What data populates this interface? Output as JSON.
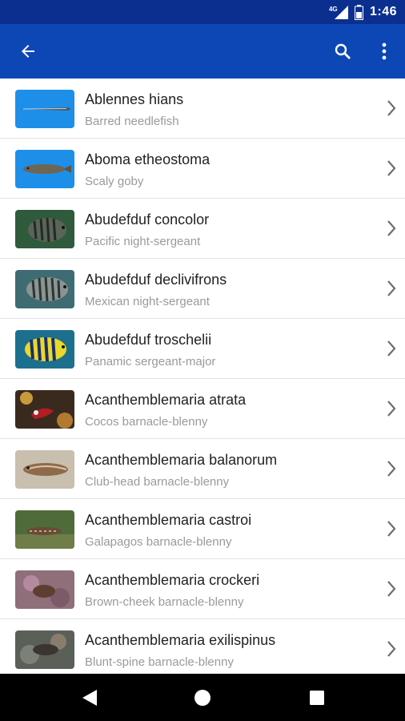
{
  "status_bar": {
    "network": "4G",
    "time": "1:46"
  },
  "app_bar": {
    "back_icon": "arrow-left-icon",
    "search_icon": "search-icon",
    "menu_icon": "more-vert-icon"
  },
  "species": [
    {
      "scientific": "Ablennes hians",
      "common": "Barred needlefish"
    },
    {
      "scientific": "Aboma etheostoma",
      "common": "Scaly goby"
    },
    {
      "scientific": "Abudefduf concolor",
      "common": "Pacific night-sergeant"
    },
    {
      "scientific": "Abudefduf declivifrons",
      "common": "Mexican night-sergeant"
    },
    {
      "scientific": "Abudefduf troschelii",
      "common": "Panamic sergeant-major"
    },
    {
      "scientific": "Acanthemblemaria atrata",
      "common": "Cocos barnacle-blenny"
    },
    {
      "scientific": "Acanthemblemaria balanorum",
      "common": "Club-head barnacle-blenny"
    },
    {
      "scientific": "Acanthemblemaria castroi",
      "common": "Galapagos barnacle-blenny"
    },
    {
      "scientific": "Acanthemblemaria crockeri",
      "common": "Brown-cheek barnacle-blenny"
    },
    {
      "scientific": "Acanthemblemaria exilispinus",
      "common": "Blunt-spine barnacle-blenny"
    }
  ],
  "nav_bar": {
    "back_icon": "triangle-back-icon",
    "home_icon": "circle-home-icon",
    "recents_icon": "square-recents-icon"
  },
  "colors": {
    "status_bar": "#0a2f8f",
    "app_bar": "#0d47b5",
    "divider": "#e3e3e3",
    "secondary_text": "#9a9a9a"
  }
}
